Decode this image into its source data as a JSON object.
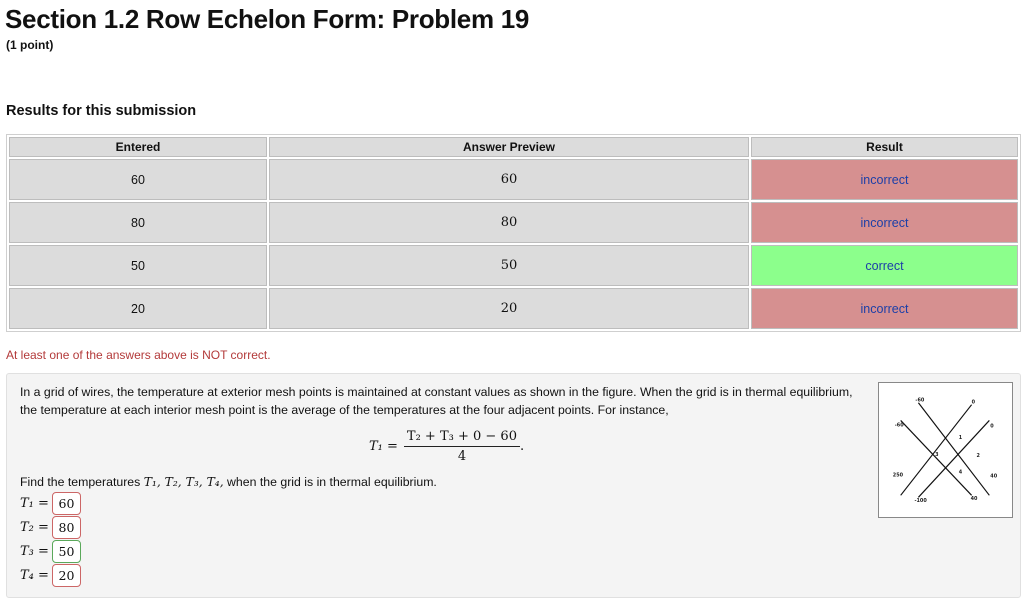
{
  "header": {
    "title": "Section 1.2 Row Echelon Form: Problem 19",
    "points": "(1 point)"
  },
  "results": {
    "heading": "Results for this submission",
    "columns": [
      "Entered",
      "Answer Preview",
      "Result"
    ],
    "rows": [
      {
        "entered": "60",
        "preview": "60",
        "result": "incorrect"
      },
      {
        "entered": "80",
        "preview": "80",
        "result": "incorrect"
      },
      {
        "entered": "50",
        "preview": "50",
        "result": "correct"
      },
      {
        "entered": "20",
        "preview": "20",
        "result": "incorrect"
      }
    ],
    "warning": "At least one of the answers above is NOT correct."
  },
  "problem": {
    "text": "In a grid of wires, the temperature at exterior mesh points is maintained at constant values as shown in the figure. When the grid is in thermal equilibrium, the temperature at each interior mesh point is the average of the temperatures at the four adjacent points. For instance,",
    "formula_lhs": "T₁ =",
    "formula_num": "T₂ + T₃ + 0 − 60",
    "formula_den": "4",
    "find_prefix": "Find the temperatures ",
    "find_vars": "T₁, T₂, T₃, T₄,",
    "find_suffix": " when the grid is in thermal equilibrium.",
    "answers": [
      {
        "label": "T₁ =",
        "value": "60",
        "status": "incorrect"
      },
      {
        "label": "T₂ =",
        "value": "80",
        "status": "incorrect"
      },
      {
        "label": "T₃ =",
        "value": "50",
        "status": "correct"
      },
      {
        "label": "T₄ =",
        "value": "20",
        "status": "incorrect"
      }
    ],
    "figure": {
      "labels": {
        "top_left": "-60",
        "top_right": "0",
        "left": "-60",
        "right_top": "0",
        "right": "40",
        "bottom_left": "250",
        "bottom": "-100",
        "bottom_right": "40",
        "t1": "1",
        "t2": "2",
        "t3": "3",
        "t4": "4"
      }
    }
  },
  "colors": {
    "incorrect_bg": "#d69090",
    "correct_bg": "#8cff8c",
    "result_text": "#1c3fa8",
    "warning_text": "#b33a3a"
  }
}
